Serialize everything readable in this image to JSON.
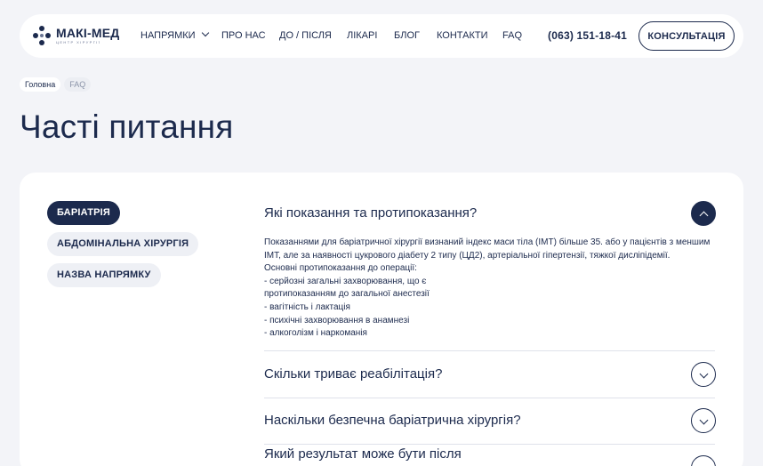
{
  "header": {
    "logo": {
      "name": "МАКІ-МЕД",
      "subtitle": "ЦЕНТР ХІРУРГІЇ"
    },
    "nav": [
      {
        "label": "НАПРЯМКИ",
        "has_dropdown": true
      },
      {
        "label": "ПРО НАС"
      },
      {
        "label": "ДО / ПІСЛЯ"
      },
      {
        "label": "ЛІКАРІ"
      },
      {
        "label": "БЛОГ"
      },
      {
        "label": "КОНТАКТИ"
      },
      {
        "label": "FAQ"
      }
    ],
    "phone": "(063) 151-18-41",
    "cta_label": "КОНСУЛЬТАЦІЯ"
  },
  "breadcrumb": [
    "Головна",
    "FAQ"
  ],
  "page_title": "Часті питання",
  "categories": [
    {
      "label": "БАРІАТРІЯ",
      "active": true
    },
    {
      "label": "АБДОМІНАЛЬНА ХІРУРГІЯ",
      "active": false
    },
    {
      "label": "НАЗВА НАПРЯМКУ",
      "active": false
    }
  ],
  "faq": [
    {
      "question": "Які показання та протипоказання?",
      "expanded": true,
      "answer_lines": [
        "Показаннями для баріатричної хірургії визнаний індекс маси тіла (ІМТ) більше 35. або у пацієнтів з меншим",
        "ІМТ, але за наявності цукрового діабету 2 типу (ЦД2), артеріальної гіпертензії, тяжкої дисліпідемії.",
        "Основні протипоказання до операції:",
        "- серйозні загальні захворювання, що є",
        "протипоказанням до загальної анестезії",
        "- вагітність і лактація",
        "- психічні захворювання в анамнезі",
        "- алкоголізм і наркоманія"
      ]
    },
    {
      "question": "Скільки триває реабілітація?",
      "expanded": false
    },
    {
      "question": "Наскільки безпечна баріатрична хірургія?",
      "expanded": false
    },
    {
      "question": "Який результат може бути після",
      "expanded": false
    }
  ],
  "colors": {
    "primary": "#1c2a4d",
    "background": "#f3f4f8",
    "card": "#ffffff"
  }
}
